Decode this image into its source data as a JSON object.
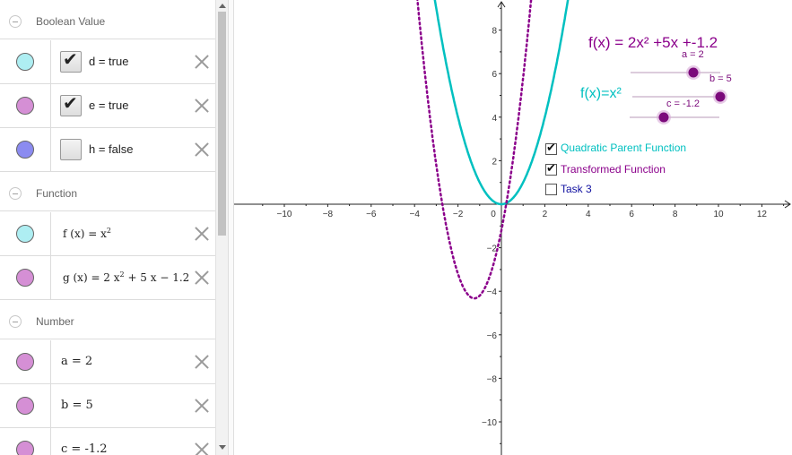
{
  "colors": {
    "cyan": "#00c0c0",
    "purple": "#8b008b",
    "slider_point": "#7b0a7b",
    "task_blue": "#1010a0",
    "marble_cyan": "#aeeef2",
    "marble_pink": "#d58fd5",
    "marble_blue": "#8b8bf0"
  },
  "algebra": {
    "groups": [
      {
        "title": "Boolean Value"
      },
      {
        "title": "Function"
      },
      {
        "title": "Number"
      }
    ],
    "booleans": [
      {
        "name": "d",
        "value": "true",
        "text": "d = true",
        "checked": true
      },
      {
        "name": "e",
        "value": "true",
        "text": "e = true",
        "checked": true
      },
      {
        "name": "h",
        "value": "false",
        "text": "h = false",
        "checked": false
      }
    ],
    "functions": [
      {
        "text": "f (x) = x",
        "exp": "2"
      },
      {
        "text_a": "g (x) = 2 x",
        "exp": "2",
        "text_b": " + 5 x − 1.2"
      }
    ],
    "numbers": [
      {
        "text": "a = 2"
      },
      {
        "text": "b = 5"
      },
      {
        "text": "c = -1.2"
      }
    ]
  },
  "graphics": {
    "x_ticks": [
      "−10",
      "−8",
      "−6",
      "−4",
      "−2",
      "0",
      "2",
      "4",
      "6",
      "8",
      "10",
      "12"
    ],
    "y_ticks": [
      "8",
      "6",
      "4",
      "2",
      "−2",
      "−4",
      "−6",
      "−8",
      "−10"
    ],
    "transformed_label": "f(x) = 2x² +5x +-1.2",
    "parent_label": "f(x)=x²",
    "sliders": [
      {
        "label": "a = 2",
        "value": 2,
        "min": -5,
        "max": 5
      },
      {
        "label": "b = 5",
        "value": 5,
        "min": -5,
        "max": 5
      },
      {
        "label": "c = -1.2",
        "value": -1.2,
        "min": -5,
        "max": 5
      }
    ],
    "checkboxes": [
      {
        "label": "Quadratic Parent Function",
        "checked": true
      },
      {
        "label": "Transformed Function",
        "checked": true
      },
      {
        "label": "Task 3",
        "checked": false
      }
    ]
  }
}
